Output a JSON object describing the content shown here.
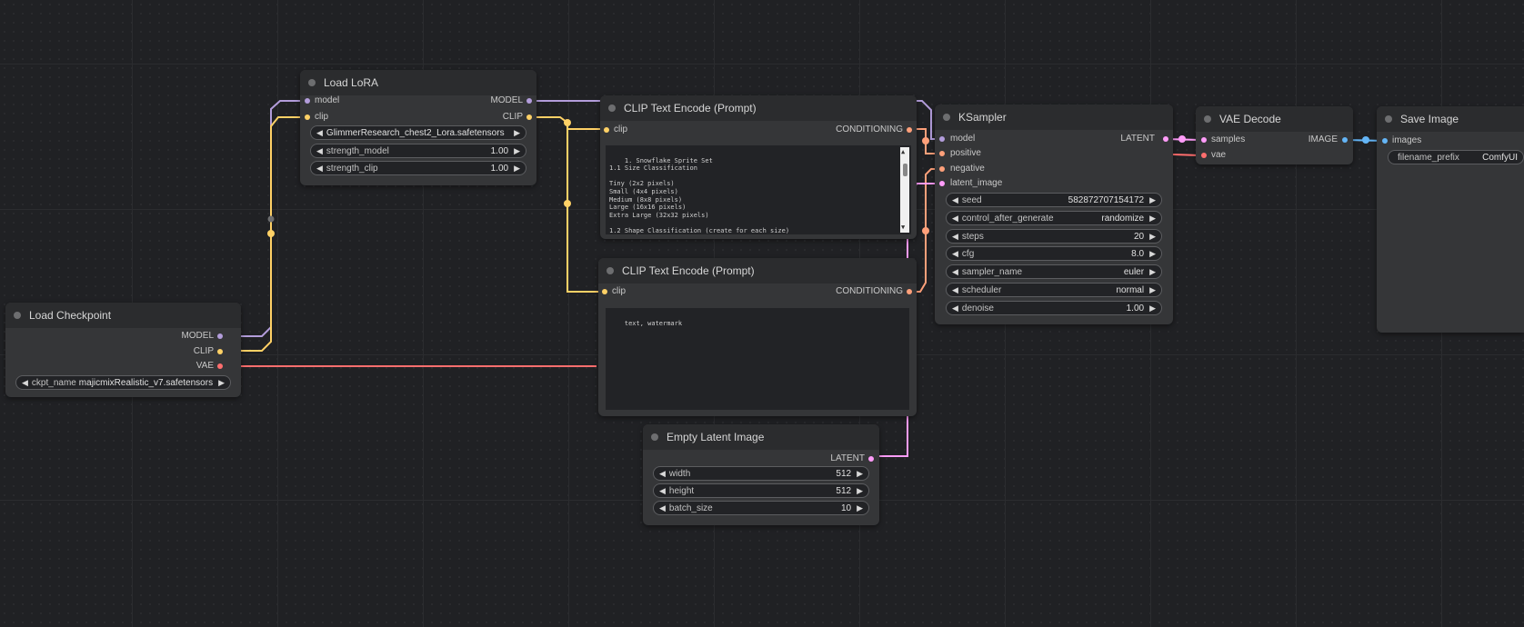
{
  "colors": {
    "model": "#b39ddb",
    "clip": "#ffd166",
    "vae": "#ff6e6e",
    "conditioning": "#ffa07a",
    "latent": "#ff9cf9",
    "image": "#64b5f6",
    "background": "#202124",
    "node": "#353638"
  },
  "nodes": {
    "load_checkpoint": {
      "title": "Load Checkpoint",
      "outputs": {
        "model": "MODEL",
        "clip": "CLIP",
        "vae": "VAE"
      },
      "widgets": {
        "ckpt_name": {
          "name": "ckpt_name",
          "value": "majicmixRealistic_v7.safetensors"
        }
      }
    },
    "load_lora": {
      "title": "Load LoRA",
      "inputs": {
        "model": "model",
        "clip": "clip"
      },
      "outputs": {
        "model": "MODEL",
        "clip": "CLIP"
      },
      "widgets": {
        "lora_name": {
          "name": "lora_name",
          "value": "GlimmerResearch_chest2_Lora.safetensors"
        },
        "strength_model": {
          "name": "strength_model",
          "value": "1.00"
        },
        "strength_clip": {
          "name": "strength_clip",
          "value": "1.00"
        }
      }
    },
    "clip_positive": {
      "title": "CLIP Text Encode (Prompt)",
      "inputs": {
        "clip": "clip"
      },
      "outputs": {
        "conditioning": "CONDITIONING"
      },
      "text": "1. Snowflake Sprite Set\n1.1 Size Classification\n\nTiny (2x2 pixels)\nSmall (4x4 pixels)\nMedium (8x8 pixels)\nLarge (16x16 pixels)\nExtra Large (32x32 pixels)\n\n1.2 Shape Classification (create for each size)"
    },
    "clip_negative": {
      "title": "CLIP Text Encode (Prompt)",
      "inputs": {
        "clip": "clip"
      },
      "outputs": {
        "conditioning": "CONDITIONING"
      },
      "text": "text, watermark"
    },
    "empty_latent": {
      "title": "Empty Latent Image",
      "outputs": {
        "latent": "LATENT"
      },
      "widgets": {
        "width": {
          "name": "width",
          "value": "512"
        },
        "height": {
          "name": "height",
          "value": "512"
        },
        "batch_size": {
          "name": "batch_size",
          "value": "10"
        }
      }
    },
    "ksampler": {
      "title": "KSampler",
      "inputs": {
        "model": "model",
        "positive": "positive",
        "negative": "negative",
        "latent_image": "latent_image"
      },
      "outputs": {
        "latent": "LATENT"
      },
      "widgets": {
        "seed": {
          "name": "seed",
          "value": "582872707154172"
        },
        "control_after_generate": {
          "name": "control_after_generate",
          "value": "randomize"
        },
        "steps": {
          "name": "steps",
          "value": "20"
        },
        "cfg": {
          "name": "cfg",
          "value": "8.0"
        },
        "sampler_name": {
          "name": "sampler_name",
          "value": "euler"
        },
        "scheduler": {
          "name": "scheduler",
          "value": "normal"
        },
        "denoise": {
          "name": "denoise",
          "value": "1.00"
        }
      }
    },
    "vae_decode": {
      "title": "VAE Decode",
      "inputs": {
        "samples": "samples",
        "vae": "vae"
      },
      "outputs": {
        "image": "IMAGE"
      }
    },
    "save_image": {
      "title": "Save Image",
      "inputs": {
        "images": "images"
      },
      "widgets": {
        "filename_prefix": {
          "name": "filename_prefix",
          "value": "ComfyUI"
        }
      }
    }
  }
}
